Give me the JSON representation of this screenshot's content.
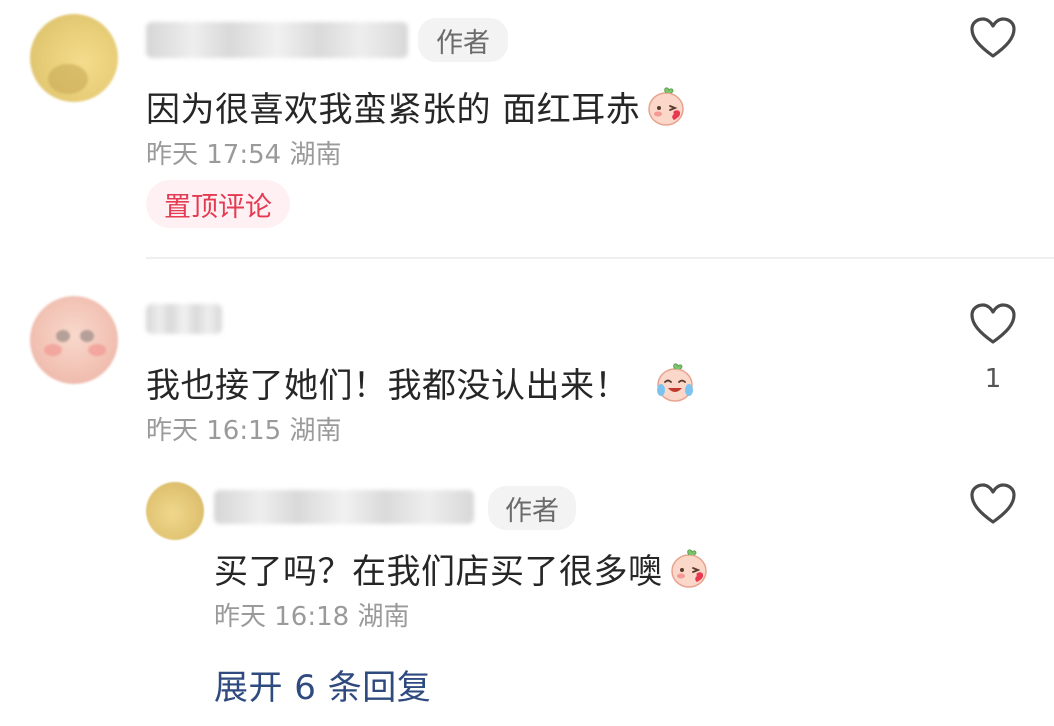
{
  "comments": [
    {
      "author_tag": "作者",
      "text": "因为很喜欢我蛮紧张的 面红耳赤",
      "emoji": "blushing-peach-emoji",
      "time": "昨天 17:54",
      "location": "湖南",
      "pinned_label": "置顶评论"
    },
    {
      "text": "我也接了她们！我都没认出来！",
      "emoji": "laughing-crying-peach-emoji",
      "time": "昨天 16:15",
      "location": "湖南",
      "like_count": "1",
      "reply": {
        "author_tag": "作者",
        "text": "买了吗？在我们店买了很多噢",
        "emoji": "blushing-peach-emoji",
        "time": "昨天 16:18",
        "location": "湖南"
      }
    }
  ],
  "expand_label": "展开 6 条回复",
  "colors": {
    "accent_pinned": "#e63a53",
    "link": "#2f4a7f",
    "meta": "#9a9a9a"
  }
}
